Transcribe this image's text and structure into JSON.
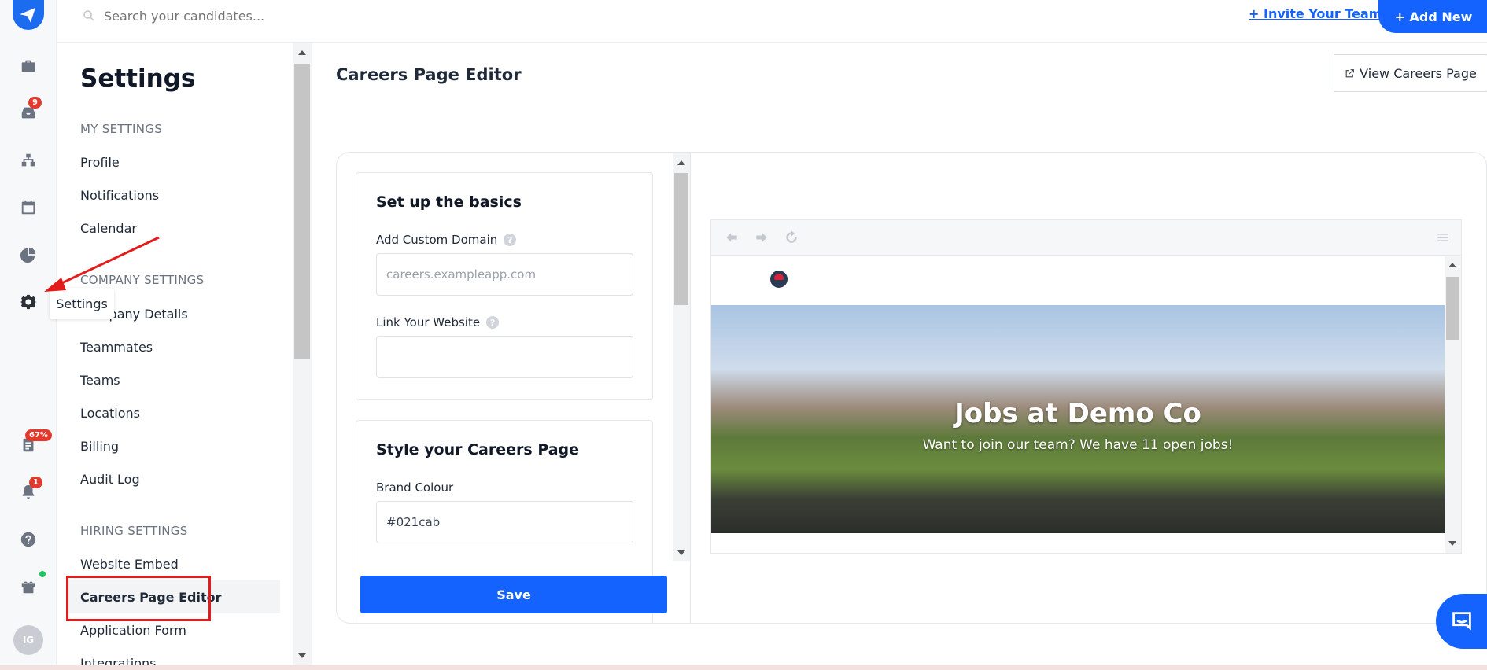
{
  "topbar": {
    "search_placeholder": "Search your candidates...",
    "invite_label": "Invite Your Team",
    "add_new_label": "Add New"
  },
  "rail": {
    "inbox_badge": "9",
    "progress_badge": "67%",
    "notifications_badge": "1",
    "avatar_initials": "IG",
    "tooltip": "Settings"
  },
  "nav": {
    "title": "Settings",
    "my_settings_header": "MY SETTINGS",
    "my_settings": [
      "Profile",
      "Notifications",
      "Calendar"
    ],
    "company_settings_header": "COMPANY SETTINGS",
    "company_settings": [
      "Company Details",
      "Teammates",
      "Teams",
      "Locations",
      "Billing",
      "Audit Log"
    ],
    "hiring_settings_header": "HIRING SETTINGS",
    "hiring_settings": [
      "Website Embed",
      "Careers Page Editor",
      "Application Form",
      "Integrations"
    ]
  },
  "main": {
    "page_title": "Careers Page Editor",
    "view_careers_label": "View Careers Page"
  },
  "editor": {
    "basics_title": "Set up the basics",
    "custom_domain_label": "Add Custom Domain",
    "custom_domain_placeholder": "careers.exampleapp.com",
    "website_label": "Link Your Website",
    "website_value": "",
    "style_title": "Style your Careers Page",
    "brand_colour_label": "Brand Colour",
    "brand_colour_value": "#021cab",
    "save_label": "Save"
  },
  "preview": {
    "hero_title": "Jobs at Demo Co",
    "hero_subtitle": "Want to join our team? We have 11 open jobs!"
  },
  "colors": {
    "accent": "#1463ff",
    "badge": "#e23b2e",
    "highlight": "#e31b1b"
  }
}
